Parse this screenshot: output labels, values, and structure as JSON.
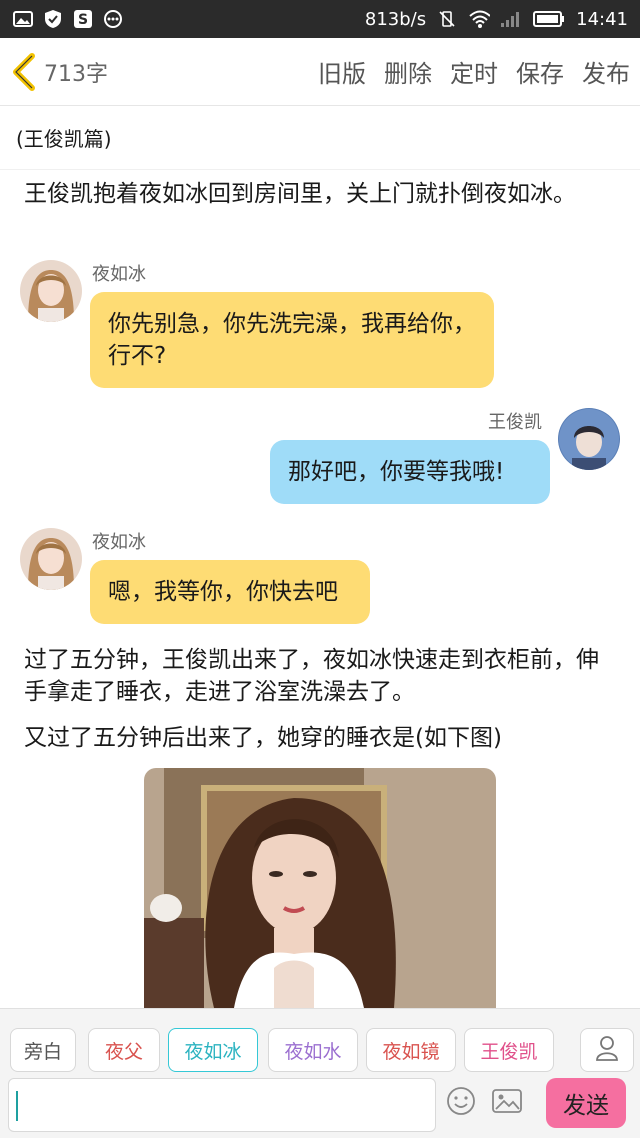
{
  "status_bar": {
    "net_speed": "813b/s",
    "time": "14:41"
  },
  "toolbar": {
    "word_count": "713字",
    "actions": [
      "旧版",
      "删除",
      "定时",
      "保存",
      "发布"
    ]
  },
  "chapter": {
    "title": "(王俊凯篇)"
  },
  "story": {
    "para1": "王俊凯抱着夜如冰回到房间里，关上门就扑倒夜如冰。",
    "msg1": {
      "speaker": "夜如冰",
      "text": "你先别急，你先洗完澡，我再给你，行不?"
    },
    "msg2": {
      "speaker": "王俊凯",
      "text": "那好吧，你要等我哦!"
    },
    "msg3": {
      "speaker": "夜如冰",
      "text": "嗯，我等你，你快去吧"
    },
    "para2": "过了五分钟，王俊凯出来了，夜如冰快速走到衣柜前，伸手拿走了睡衣，走进了浴室洗澡去了。",
    "para3": "又过了五分钟后出来了，她穿的睡衣是(如下图)"
  },
  "chips": [
    {
      "label": "旁白",
      "color": "#555555"
    },
    {
      "label": "夜父",
      "color": "#d9534f"
    },
    {
      "label": "夜如冰",
      "color": "#2bb3c0"
    },
    {
      "label": "夜如水",
      "color": "#9b6fd0"
    },
    {
      "label": "夜如镜",
      "color": "#d9534f"
    },
    {
      "label": "王俊凯",
      "color": "#e0508a"
    }
  ],
  "input": {
    "send_label": "发送",
    "value": ""
  },
  "colors": {
    "yellow_bubble": "#fedc74",
    "blue_bubble": "#9fdcf8",
    "send": "#f56fa0"
  },
  "icons": [
    "image-icon",
    "shield-icon",
    "s-icon",
    "more-icon",
    "wifi-icon",
    "signal-icon",
    "battery-icon",
    "back-chevron-icon",
    "user-icon",
    "emoji-icon",
    "picture-icon"
  ]
}
